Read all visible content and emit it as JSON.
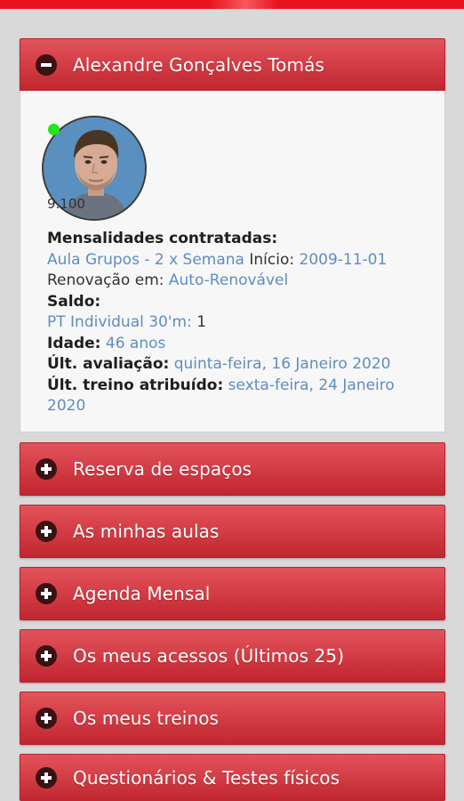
{
  "profile": {
    "name": "Alexandre Gonçalves Tomás",
    "avatar_code": "9.100",
    "contracted_label": "Mensalidades contratadas:",
    "plan_name": "Aula Grupos - 2 x Semana",
    "start_label": "Início:",
    "start_date": "2009-11-01",
    "renewal_label": "Renovação em:",
    "renewal_value": "Auto-Renovável",
    "balance_label": "Saldo:",
    "balance_item": "PT Individual 30'm:",
    "balance_value": "1",
    "age_label": "Idade:",
    "age_value": "46 anos",
    "last_eval_label": "Últ. avaliação:",
    "last_eval_value": "quinta-feira, 16 Janeiro 2020",
    "last_training_label": "Últ. treino atribuído:",
    "last_training_value": "sexta-feira, 24 Janeiro 2020"
  },
  "sections": [
    "Reserva de espaços",
    "As minhas aulas",
    "Agenda Mensal",
    "Os meus acessos (Últimos 25)",
    "Os meus treinos",
    "Questionários & Testes físicos"
  ],
  "colors": {
    "accent_red": "#d13a43",
    "top_bar_red": "#e8141c",
    "link_blue": "#5f8dc0",
    "online_green": "#21e619",
    "icon_dark": "#3a1214"
  },
  "icons": {
    "collapse": "minus-circle-icon",
    "expand": "plus-circle-icon",
    "status": "online-dot-icon"
  }
}
